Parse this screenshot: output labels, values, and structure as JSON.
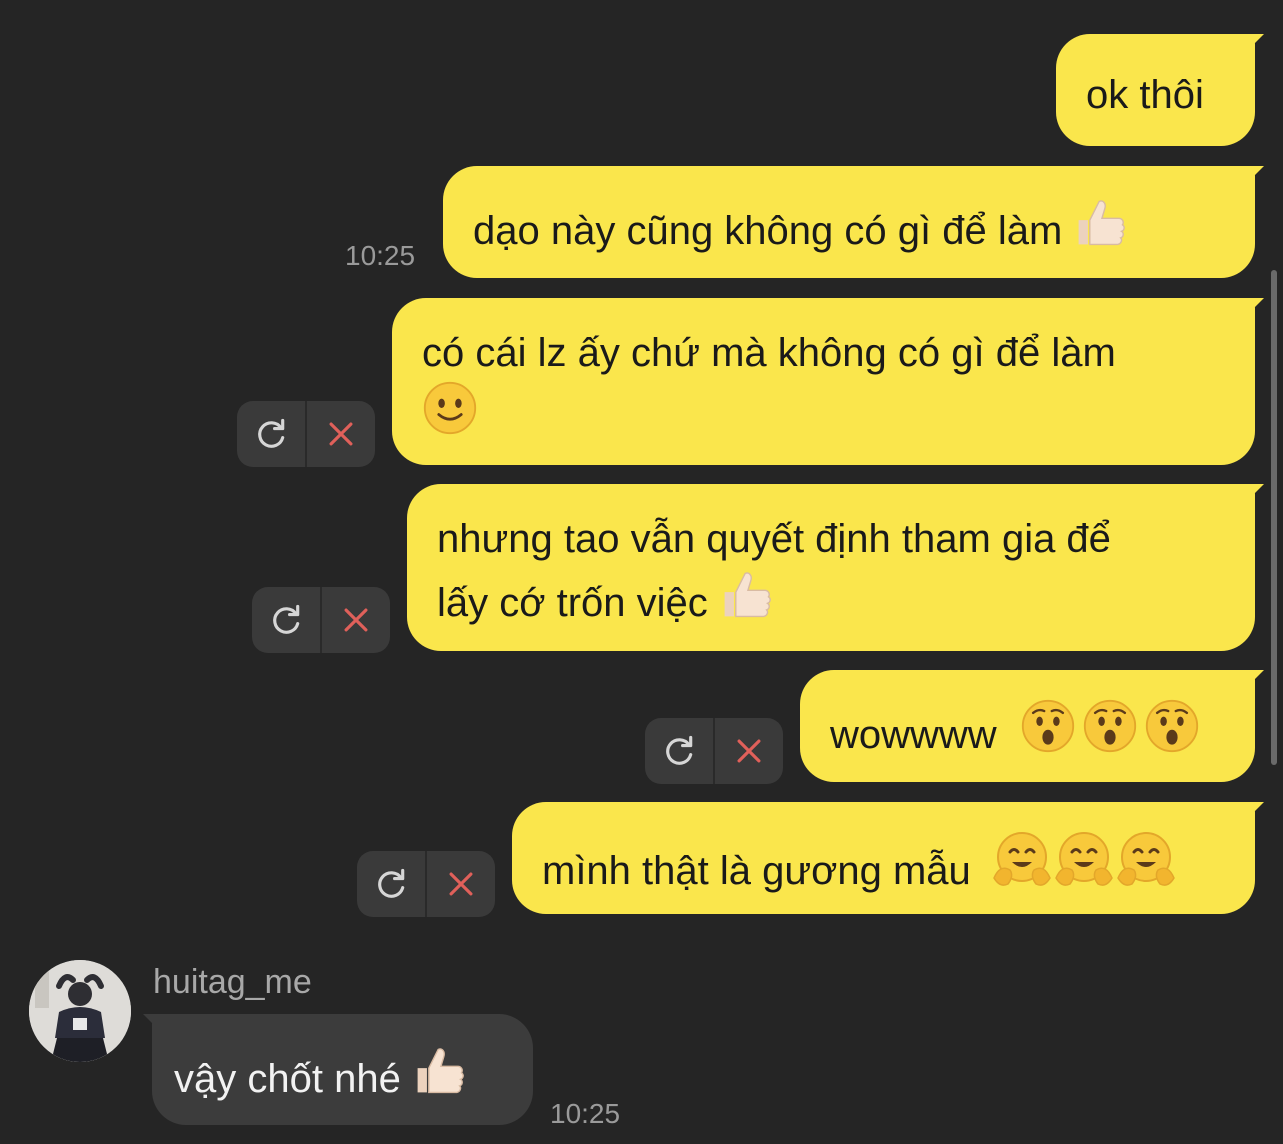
{
  "messages": {
    "m1": {
      "text": "ok thôi"
    },
    "m2": {
      "text": "dạo này cũng không có gì để làm",
      "emoji": "thumbs-up",
      "time": "10:25"
    },
    "m3": {
      "line1": "có cái lz ấy chứ mà không có gì để làm",
      "emoji": "slightly-smiling-face"
    },
    "m4": {
      "line1": "nhưng tao vẫn quyết định tham gia để",
      "line2": "lấy cớ trốn việc",
      "emoji": "thumbs-up"
    },
    "m5": {
      "text": "wowwww",
      "emoji": "hushed-face x3"
    },
    "m6": {
      "text": "mình thật là gương mẫu",
      "emoji": "hugging-face x3"
    },
    "reply": {
      "sender": "huitag_me",
      "text": "vậy chốt nhé",
      "emoji": "thumbs-up",
      "time": "10:25"
    }
  },
  "colors": {
    "background": "#252525",
    "outgoing_bubble": "#FAE64C",
    "incoming_bubble": "#3c3c3c",
    "retry_icon": "#d6d6d6",
    "delete_icon": "#e0605a",
    "timestamp": "#9a9a9a"
  },
  "icons": {
    "retry": "retry-icon",
    "delete": "close-icon"
  }
}
